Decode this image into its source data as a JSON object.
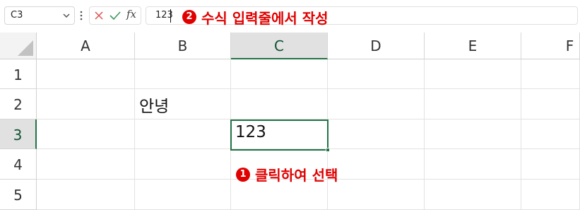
{
  "formula_bar": {
    "name_box": "C3",
    "fx_label": "fx",
    "formula_value": "123"
  },
  "annotations": {
    "step2": {
      "number": "2",
      "text": "수식 입력줄에서 작성"
    },
    "step1": {
      "number": "1",
      "text": "클릭하여 선택"
    }
  },
  "grid": {
    "columns": [
      "A",
      "B",
      "C",
      "D",
      "E",
      "F"
    ],
    "rows": [
      "1",
      "2",
      "3",
      "4",
      "5"
    ],
    "selected_column": "C",
    "selected_row": "3",
    "cells": {
      "B2": "안녕",
      "C3": "123"
    }
  },
  "colors": {
    "accent_green": "#217346",
    "annotation_red": "#e00000"
  }
}
